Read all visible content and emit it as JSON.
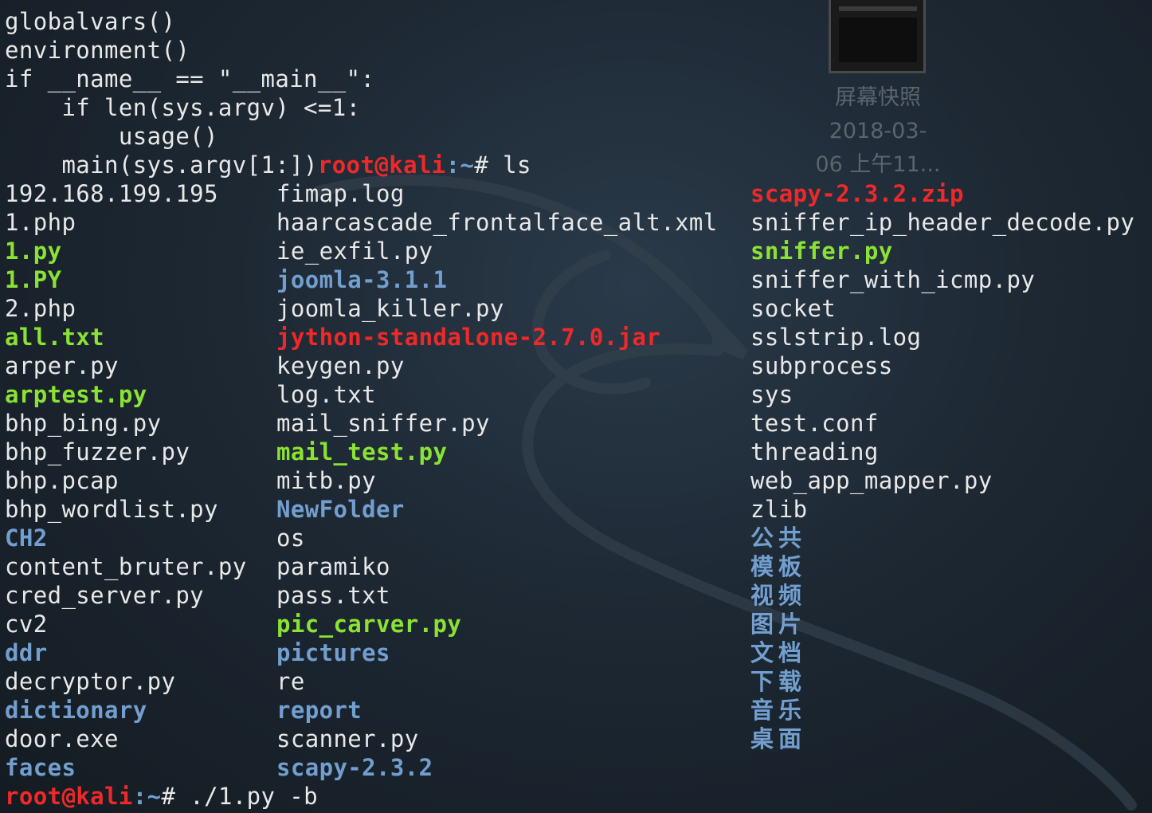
{
  "desktop_icon": {
    "label_lines": [
      "屏幕快照",
      "2018-03-",
      "06 上午11..."
    ],
    "icon": "screenshot-thumbnail-icon"
  },
  "terminal": {
    "code_lines": [
      "globalvars()",
      "environment()",
      "if __name__ == \"__main__\":",
      "    if len(sys.argv) <=1:",
      "        usage()",
      "    main(sys.argv[1:])"
    ],
    "prompt_user": "root@kali",
    "prompt_path": ":~",
    "prompt_symbol": "# ",
    "first_command": "ls",
    "second_command": "./1.py -b",
    "columns": [
      [
        {
          "name": "192.168.199.195",
          "type": "file"
        },
        {
          "name": "1.php",
          "type": "file"
        },
        {
          "name": "1.py",
          "type": "exec"
        },
        {
          "name": "1.PY",
          "type": "exec"
        },
        {
          "name": "2.php",
          "type": "file"
        },
        {
          "name": "all.txt",
          "type": "exec"
        },
        {
          "name": "arper.py",
          "type": "file"
        },
        {
          "name": "arptest.py",
          "type": "exec"
        },
        {
          "name": "bhp_bing.py",
          "type": "file"
        },
        {
          "name": "bhp_fuzzer.py",
          "type": "file"
        },
        {
          "name": "bhp.pcap",
          "type": "file"
        },
        {
          "name": "bhp_wordlist.py",
          "type": "file"
        },
        {
          "name": "CH2",
          "type": "dir"
        },
        {
          "name": "content_bruter.py",
          "type": "file"
        },
        {
          "name": "cred_server.py",
          "type": "file"
        },
        {
          "name": "cv2",
          "type": "file"
        },
        {
          "name": "ddr",
          "type": "dir"
        },
        {
          "name": "decryptor.py",
          "type": "file"
        },
        {
          "name": "dictionary",
          "type": "dir"
        },
        {
          "name": "door.exe",
          "type": "file"
        },
        {
          "name": "faces",
          "type": "dir"
        }
      ],
      [
        {
          "name": "fimap.log",
          "type": "file"
        },
        {
          "name": "haarcascade_frontalface_alt.xml",
          "type": "file"
        },
        {
          "name": "ie_exfil.py",
          "type": "file"
        },
        {
          "name": "joomla-3.1.1",
          "type": "dir"
        },
        {
          "name": "joomla_killer.py",
          "type": "file"
        },
        {
          "name": "jython-standalone-2.7.0.jar",
          "type": "arch"
        },
        {
          "name": "keygen.py",
          "type": "file"
        },
        {
          "name": "log.txt",
          "type": "file"
        },
        {
          "name": "mail_sniffer.py",
          "type": "file"
        },
        {
          "name": "mail_test.py",
          "type": "exec"
        },
        {
          "name": "mitb.py",
          "type": "file"
        },
        {
          "name": "NewFolder",
          "type": "dir"
        },
        {
          "name": "os",
          "type": "file"
        },
        {
          "name": "paramiko",
          "type": "file"
        },
        {
          "name": "pass.txt",
          "type": "file"
        },
        {
          "name": "pic_carver.py",
          "type": "exec"
        },
        {
          "name": "pictures",
          "type": "dir"
        },
        {
          "name": "re",
          "type": "file"
        },
        {
          "name": "report",
          "type": "dir"
        },
        {
          "name": "scanner.py",
          "type": "file"
        },
        {
          "name": "scapy-2.3.2",
          "type": "dir"
        }
      ],
      [
        {
          "name": "scapy-2.3.2.zip",
          "type": "arch"
        },
        {
          "name": "sniffer_ip_header_decode.py",
          "type": "file"
        },
        {
          "name": "sniffer.py",
          "type": "exec"
        },
        {
          "name": "sniffer_with_icmp.py",
          "type": "file"
        },
        {
          "name": "socket",
          "type": "file"
        },
        {
          "name": "sslstrip.log",
          "type": "file"
        },
        {
          "name": "subprocess",
          "type": "file"
        },
        {
          "name": "sys",
          "type": "file"
        },
        {
          "name": "test.conf",
          "type": "file"
        },
        {
          "name": "threading",
          "type": "file"
        },
        {
          "name": "web_app_mapper.py",
          "type": "file"
        },
        {
          "name": "zlib",
          "type": "file"
        },
        {
          "name": "公共",
          "type": "dir"
        },
        {
          "name": "模板",
          "type": "dir"
        },
        {
          "name": "视频",
          "type": "dir"
        },
        {
          "name": "图片",
          "type": "dir"
        },
        {
          "name": "文档",
          "type": "dir"
        },
        {
          "name": "下载",
          "type": "dir"
        },
        {
          "name": "音乐",
          "type": "dir"
        },
        {
          "name": "桌面",
          "type": "dir"
        }
      ]
    ]
  },
  "colors": {
    "text": "#e8e8e8",
    "exec": "#8ae234",
    "dir": "#729fcf",
    "archive": "#ef2929",
    "prompt_user": "#ef2929"
  }
}
